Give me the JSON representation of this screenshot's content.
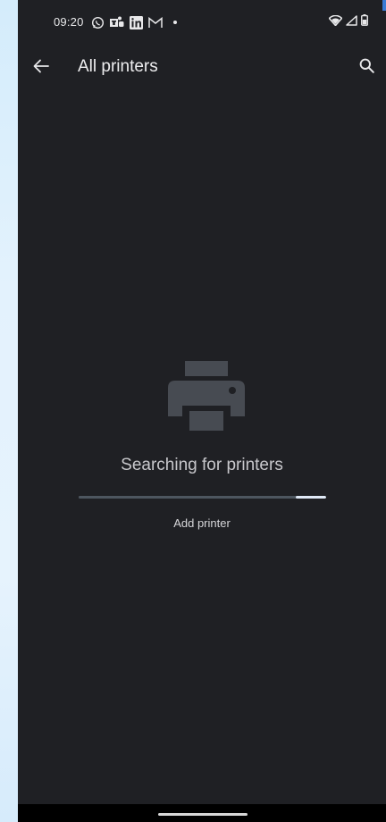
{
  "status_bar": {
    "time": "09:20",
    "left_icons": [
      "whatsapp-icon",
      "teams-icon",
      "linkedin-icon",
      "gmail-icon",
      "notification-dot"
    ],
    "right_icons": [
      "wifi-icon",
      "cellular-signal-icon",
      "battery-icon"
    ]
  },
  "app_bar": {
    "title": "All printers",
    "back_icon": "back-arrow-icon",
    "search_icon": "search-icon"
  },
  "empty_state": {
    "icon": "printer-icon",
    "message": "Searching for printers",
    "progress_state": "indeterminate",
    "add_printer_label": "Add printer"
  },
  "colors": {
    "background": "#1f2024",
    "text_primary": "#eeeef0",
    "text_secondary": "#c7c7cb",
    "progress_indicator": "#dfe9f6",
    "icon_muted": "#474b52"
  }
}
